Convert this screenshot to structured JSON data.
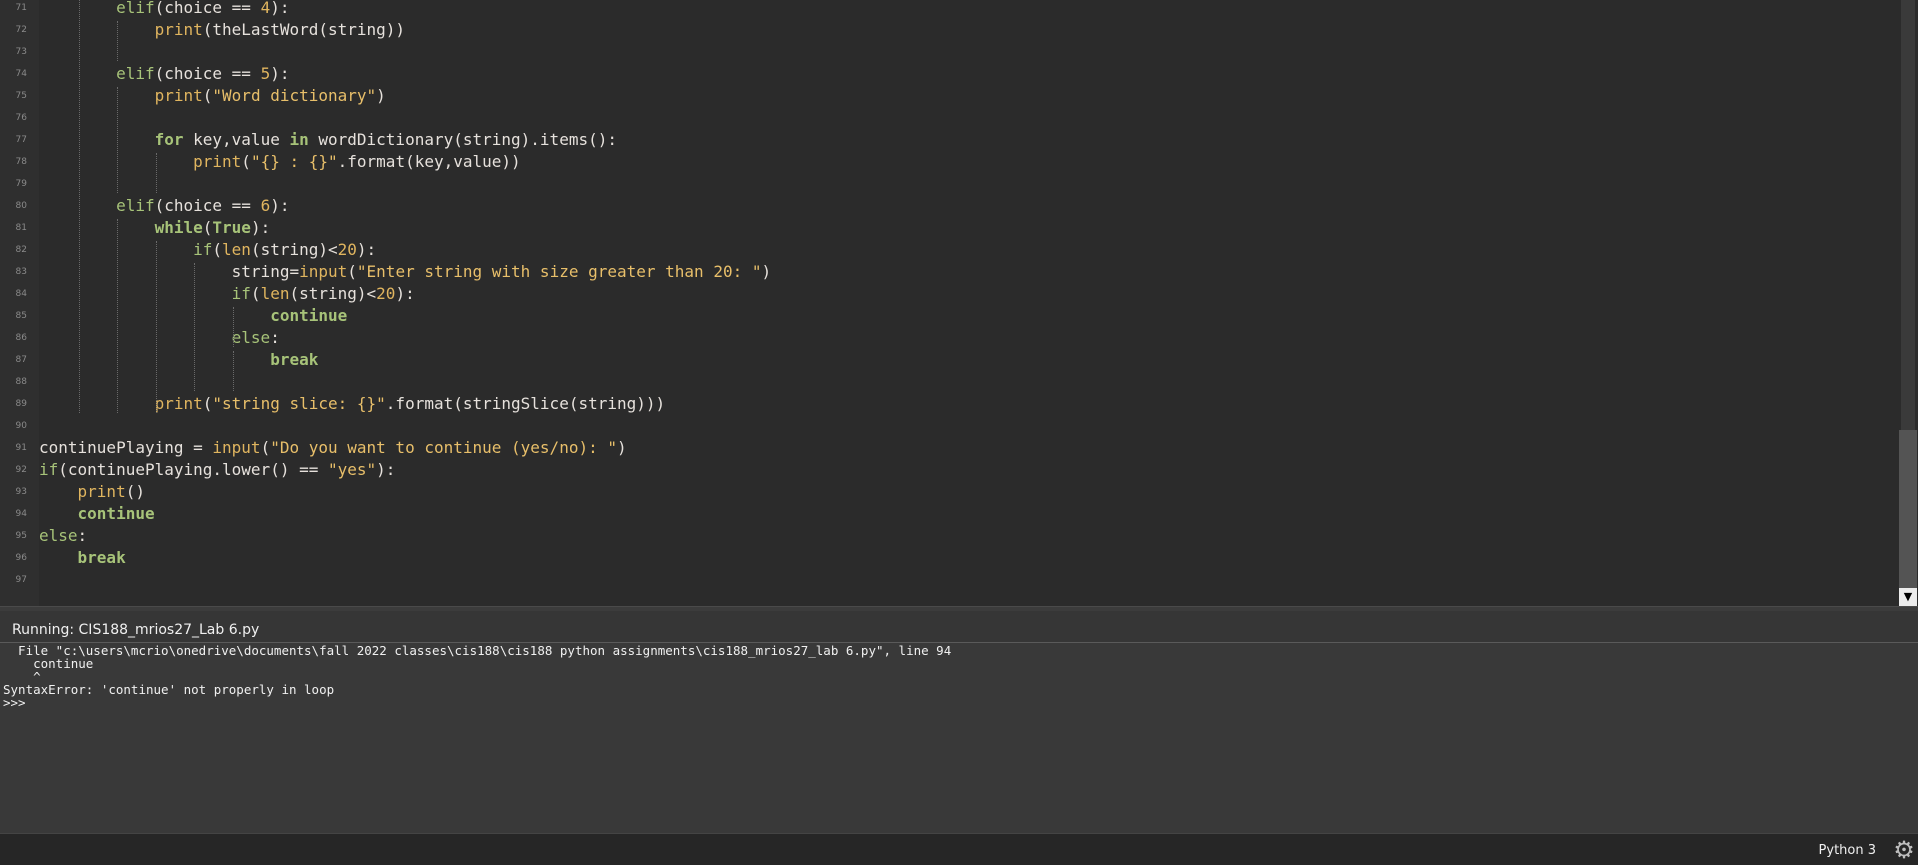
{
  "editor": {
    "lines": [
      {
        "n": "71",
        "tokens": [
          [
            "",
            "        "
          ],
          [
            "kw2",
            "elif"
          ],
          [
            "",
            "(choice == "
          ],
          [
            "num",
            "4"
          ],
          [
            "",
            "):"
          ]
        ]
      },
      {
        "n": "72",
        "tokens": [
          [
            "",
            "            "
          ],
          [
            "fn",
            "print"
          ],
          [
            "",
            "(theLastWord(string))"
          ]
        ]
      },
      {
        "n": "73",
        "tokens": []
      },
      {
        "n": "74",
        "tokens": [
          [
            "",
            "        "
          ],
          [
            "kw2",
            "elif"
          ],
          [
            "",
            "(choice == "
          ],
          [
            "num",
            "5"
          ],
          [
            "",
            "):"
          ]
        ]
      },
      {
        "n": "75",
        "tokens": [
          [
            "",
            "            "
          ],
          [
            "fn",
            "print"
          ],
          [
            "",
            "("
          ],
          [
            "str",
            "\"Word dictionary\""
          ],
          [
            "",
            ")"
          ]
        ]
      },
      {
        "n": "76",
        "tokens": []
      },
      {
        "n": "77",
        "tokens": [
          [
            "",
            "            "
          ],
          [
            "kw",
            "for"
          ],
          [
            "",
            " key,value "
          ],
          [
            "kw",
            "in"
          ],
          [
            "",
            " wordDictionary(string).items():"
          ]
        ]
      },
      {
        "n": "78",
        "tokens": [
          [
            "",
            "                "
          ],
          [
            "fn",
            "print"
          ],
          [
            "",
            "("
          ],
          [
            "str",
            "\"{} : {}\""
          ],
          [
            "",
            ".format(key,value))"
          ]
        ]
      },
      {
        "n": "79",
        "tokens": []
      },
      {
        "n": "80",
        "tokens": [
          [
            "",
            "        "
          ],
          [
            "kw2",
            "elif"
          ],
          [
            "",
            "(choice == "
          ],
          [
            "num",
            "6"
          ],
          [
            "",
            "):"
          ]
        ]
      },
      {
        "n": "81",
        "tokens": [
          [
            "",
            "            "
          ],
          [
            "kw",
            "while"
          ],
          [
            "",
            "("
          ],
          [
            "kw",
            "True"
          ],
          [
            "",
            "):"
          ]
        ]
      },
      {
        "n": "82",
        "tokens": [
          [
            "",
            "                "
          ],
          [
            "kw2",
            "if"
          ],
          [
            "",
            "("
          ],
          [
            "fn",
            "len"
          ],
          [
            "",
            "(string)<"
          ],
          [
            "num",
            "20"
          ],
          [
            "",
            "):"
          ]
        ]
      },
      {
        "n": "83",
        "tokens": [
          [
            "",
            "                    string="
          ],
          [
            "fn",
            "input"
          ],
          [
            "",
            "("
          ],
          [
            "str",
            "\"Enter string with size greater than 20: \""
          ],
          [
            "",
            ")"
          ]
        ]
      },
      {
        "n": "84",
        "tokens": [
          [
            "",
            "                    "
          ],
          [
            "kw2",
            "if"
          ],
          [
            "",
            "("
          ],
          [
            "fn",
            "len"
          ],
          [
            "",
            "(string)<"
          ],
          [
            "num",
            "20"
          ],
          [
            "",
            "):"
          ]
        ]
      },
      {
        "n": "85",
        "tokens": [
          [
            "",
            "                        "
          ],
          [
            "kw",
            "continue"
          ]
        ]
      },
      {
        "n": "86",
        "tokens": [
          [
            "",
            "                    "
          ],
          [
            "kw2",
            "else"
          ],
          [
            "",
            ":"
          ]
        ]
      },
      {
        "n": "87",
        "tokens": [
          [
            "",
            "                        "
          ],
          [
            "kw",
            "break"
          ]
        ]
      },
      {
        "n": "88",
        "tokens": []
      },
      {
        "n": "89",
        "tokens": [
          [
            "",
            "            "
          ],
          [
            "fn",
            "print"
          ],
          [
            "",
            "("
          ],
          [
            "str",
            "\"string slice: {}\""
          ],
          [
            "",
            ".format(stringSlice(string)))"
          ]
        ]
      },
      {
        "n": "90",
        "tokens": []
      },
      {
        "n": "91",
        "tokens": [
          [
            "",
            "continuePlaying = "
          ],
          [
            "fn",
            "input"
          ],
          [
            "",
            "("
          ],
          [
            "str",
            "\"Do you want to continue (yes/no): \""
          ],
          [
            "",
            ")"
          ]
        ]
      },
      {
        "n": "92",
        "tokens": [
          [
            "kw2",
            "if"
          ],
          [
            "",
            "(continuePlaying.lower() == "
          ],
          [
            "str",
            "\"yes\""
          ],
          [
            "",
            "):"
          ]
        ]
      },
      {
        "n": "93",
        "tokens": [
          [
            "",
            "    "
          ],
          [
            "fn",
            "print"
          ],
          [
            "",
            "()"
          ]
        ]
      },
      {
        "n": "94",
        "tokens": [
          [
            "",
            "    "
          ],
          [
            "kw",
            "continue"
          ]
        ]
      },
      {
        "n": "95",
        "tokens": [
          [
            "kw2",
            "else"
          ],
          [
            "",
            ":"
          ]
        ]
      },
      {
        "n": "96",
        "tokens": [
          [
            "",
            "    "
          ],
          [
            "kw",
            "break"
          ]
        ]
      },
      {
        "n": "97",
        "tokens": []
      }
    ]
  },
  "shell": {
    "title": "Running: CIS188_mrios27_Lab 6.py",
    "output_lines": [
      "  File \"c:\\users\\mcrio\\onedrive\\documents\\fall 2022 classes\\cis188\\cis188 python assignments\\cis188_mrios27_lab 6.py\", line 94",
      "    continue",
      "    ^",
      "SyntaxError: 'continue' not properly in loop",
      ">>> "
    ]
  },
  "statusbar": {
    "interpreter": "Python 3",
    "settings_icon": "gear-icon"
  },
  "colors": {
    "editor_bg": "#2b2b2b",
    "keyword": "#a7c379",
    "string": "#e8bf6a",
    "function": "#e0b55f",
    "shell_bg": "#393939"
  }
}
